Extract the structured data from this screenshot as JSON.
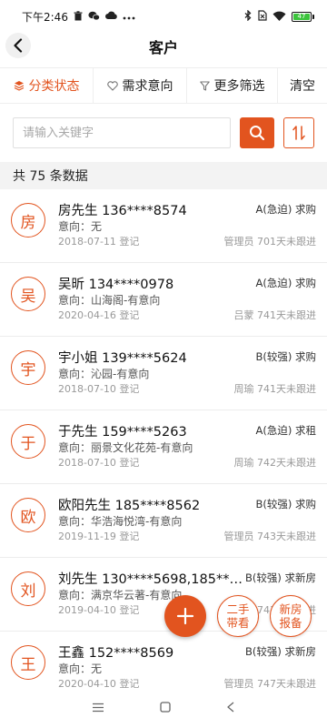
{
  "status_bar": {
    "time": "下午2:46",
    "battery": "47"
  },
  "header": {
    "title": "客户"
  },
  "filters": {
    "classify_status": "分类状态",
    "demand_intent": "需求意向",
    "more_filters": "更多筛选",
    "clear": "清空"
  },
  "search": {
    "placeholder": "请输入关键字"
  },
  "summary": {
    "count_text": "共 75 条数据"
  },
  "customers": [
    {
      "avatar": "房",
      "name": "房先生 136****8574",
      "grade": "A(急迫) 求购",
      "intent": "意向：无",
      "date": "2018-07-11 登记",
      "follow": "管理员 701天未跟进"
    },
    {
      "avatar": "吴",
      "name": "吴昕 134****0978",
      "grade": "A(急迫) 求购",
      "intent": "意向：山海阁-有意向",
      "date": "2020-04-16 登记",
      "follow": "吕蒙 741天未跟进"
    },
    {
      "avatar": "宇",
      "name": "宇小姐 139****5624",
      "grade": "B(较强) 求购",
      "intent": "意向：沁园-有意向",
      "date": "2018-07-10 登记",
      "follow": "周瑜 741天未跟进"
    },
    {
      "avatar": "于",
      "name": "于先生 159****5263",
      "grade": "A(急迫) 求租",
      "intent": "意向：丽景文化花苑-有意向",
      "date": "2018-07-10 登记",
      "follow": "周瑜 742天未跟进"
    },
    {
      "avatar": "欧",
      "name": "欧阳先生 185****8562",
      "grade": "B(较强) 求购",
      "intent": "意向：华浩海悦湾-有意向",
      "date": "2019-11-19 登记",
      "follow": "管理员 743天未跟进"
    },
    {
      "avatar": "刘",
      "name": "刘先生 130****5698,185**…",
      "grade": "B(较强) 求新房",
      "intent": "意向：满京华云著-有意向",
      "date": "2019-04-10 登记",
      "follow": "管理员 743天未跟进"
    },
    {
      "avatar": "王",
      "name": "王鑫 152****8569",
      "grade": "B(较强) 求新房",
      "intent": "意向：无",
      "date": "2020-04-10 登记",
      "follow": "管理员 747天未跟进"
    }
  ],
  "fab": {
    "ershou_line1": "二手",
    "ershou_line2": "带看",
    "xinfang_line1": "新房",
    "xinfang_line2": "报备"
  },
  "colors": {
    "accent": "#e2541f"
  }
}
